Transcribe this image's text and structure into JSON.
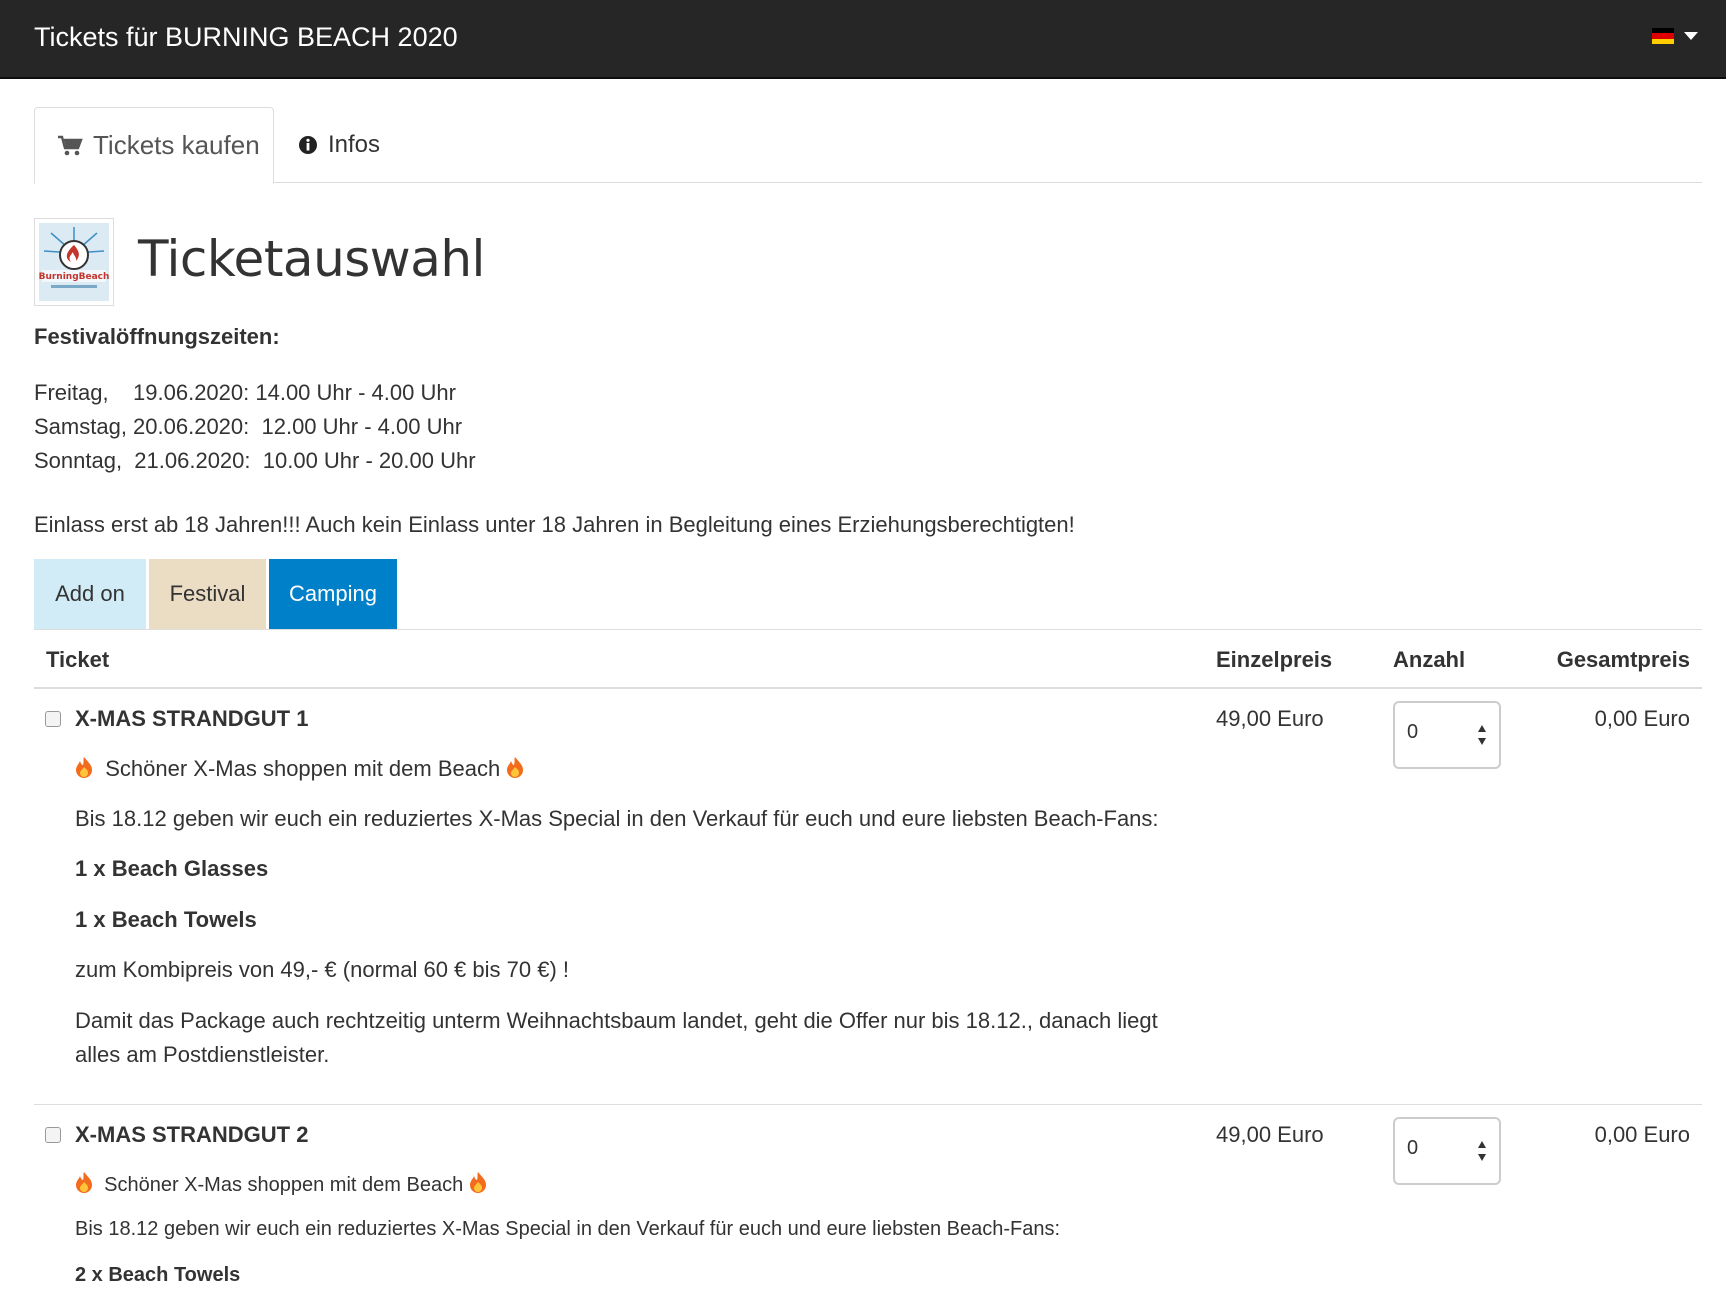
{
  "header": {
    "title": "Tickets für BURNING BEACH 2020",
    "language": {
      "flag_colors": [
        "#000000",
        "#DD0000",
        "#FFCE00"
      ]
    }
  },
  "tabs": [
    {
      "label": "Tickets kaufen",
      "icon": "cart-icon",
      "active": true
    },
    {
      "label": "Infos",
      "icon": "info-icon",
      "active": false
    }
  ],
  "page": {
    "title": "Ticketauswahl",
    "logo_text": "BurningBeach",
    "hours_heading": "Festivalöffnungszeiten:",
    "hours": [
      "Freitag,    19.06.2020: 14.00 Uhr - 4.00 Uhr",
      "Samstag, 20.06.2020:  12.00 Uhr - 4.00 Uhr",
      "Sonntag,  21.06.2020:  10.00 Uhr - 20.00 Uhr"
    ],
    "notice": "Einlass erst ab 18 Jahren!!! Auch kein Einlass unter 18 Jahren in Begleitung eines Erziehungsberechtigten!"
  },
  "categories": [
    {
      "label": "Add on",
      "color": "#d1ecf6"
    },
    {
      "label": "Festival",
      "color": "#ebdcc4"
    },
    {
      "label": "Camping",
      "color": "#0080c9"
    }
  ],
  "table": {
    "headers": {
      "ticket": "Ticket",
      "unit_price": "Einzelpreis",
      "quantity": "Anzahl",
      "total": "Gesamtpreis"
    },
    "rows": [
      {
        "name": "X-MAS STRANDGUT 1",
        "unit_price": "49,00 Euro",
        "quantity": "0",
        "total": "0,00 Euro",
        "tagline": "Schöner X-Mas shoppen mit dem Beach",
        "intro": "Bis 18.12 geben wir euch ein reduziertes X-Mas Special in den Verkauf für euch und eure liebsten Beach-Fans:",
        "item1": "1 x Beach Glasses",
        "item2": "1 x Beach Towels",
        "price_note": "zum Kombipreis von 49,- € (normal 60 € bis 70 €) !",
        "shipping_note": "Damit das Package auch rechtzeitig unterm Weihnachtsbaum landet, geht die Offer nur bis 18.12., danach liegt alles am Postdienstleister."
      },
      {
        "name": "X-MAS STRANDGUT 2",
        "unit_price": "49,00 Euro",
        "quantity": "0",
        "total": "0,00 Euro",
        "tagline": "Schöner X-Mas shoppen mit dem Beach",
        "intro": "Bis 18.12 geben wir euch ein reduziertes X-Mas Special in den Verkauf für euch und eure liebsten Beach-Fans:",
        "item1": "2 x Beach Towels"
      }
    ]
  }
}
